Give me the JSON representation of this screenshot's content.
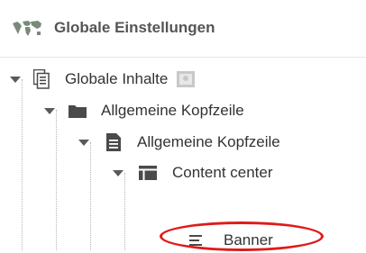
{
  "header": {
    "title": "Globale Einstellungen",
    "icon": "world-map-icon"
  },
  "tree": {
    "nodes": [
      {
        "label": "Globale Inhalte",
        "icon": "pages-icon",
        "expanded": true,
        "badge": "gallery-icon"
      },
      {
        "label": "Allgemeine Kopfzeile",
        "icon": "folder-icon",
        "expanded": true
      },
      {
        "label": "Allgemeine Kopfzeile",
        "icon": "document-icon",
        "expanded": true
      },
      {
        "label": "Content center",
        "icon": "table-layout-icon",
        "expanded": true
      },
      {
        "label": "Banner",
        "icon": "text-lines-icon",
        "expanded": false,
        "highlighted": true
      }
    ]
  },
  "colors": {
    "highlight": "#e01a1a",
    "icon_dark": "#4a4a4a",
    "text": "#333333",
    "header_text": "#555555"
  }
}
